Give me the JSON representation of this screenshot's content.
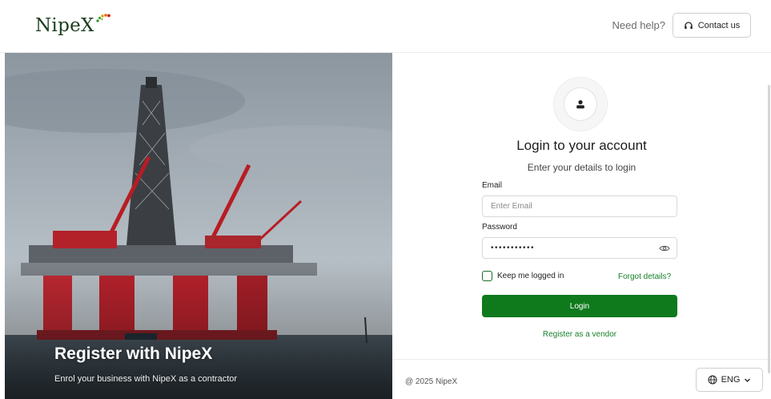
{
  "header": {
    "logo_text": "NipeX",
    "help_text": "Need help?",
    "contact_label": "Contact us",
    "contact_icon": "headset-icon"
  },
  "hero": {
    "title": "Register with NipeX",
    "subtitle": "Enrol your business with NipeX as a contractor",
    "image": "offshore-oil-rig-photo"
  },
  "login": {
    "avatar_icon": "user-icon",
    "title": "Login to your account",
    "subtitle": "Enter your details to login",
    "email_label": "Email",
    "email_placeholder": "Enter Email",
    "email_value": "",
    "password_label": "Password",
    "password_value": "•••••••••••",
    "password_icon": "eye-icon",
    "keep_logged_in_label": "Keep me logged in",
    "keep_logged_in_checked": false,
    "forgot_label": "Forgot details?",
    "login_button": "Login",
    "register_link": "Register as a vendor"
  },
  "footer": {
    "copyright": "@ 2025 NipeX",
    "language": "ENG",
    "language_icon": "globe-icon",
    "chevron_icon": "chevron-down-icon"
  },
  "colors": {
    "brand_green": "#0f7a1c",
    "link_green": "#17802a",
    "logo_dark": "#1b3e1f"
  }
}
